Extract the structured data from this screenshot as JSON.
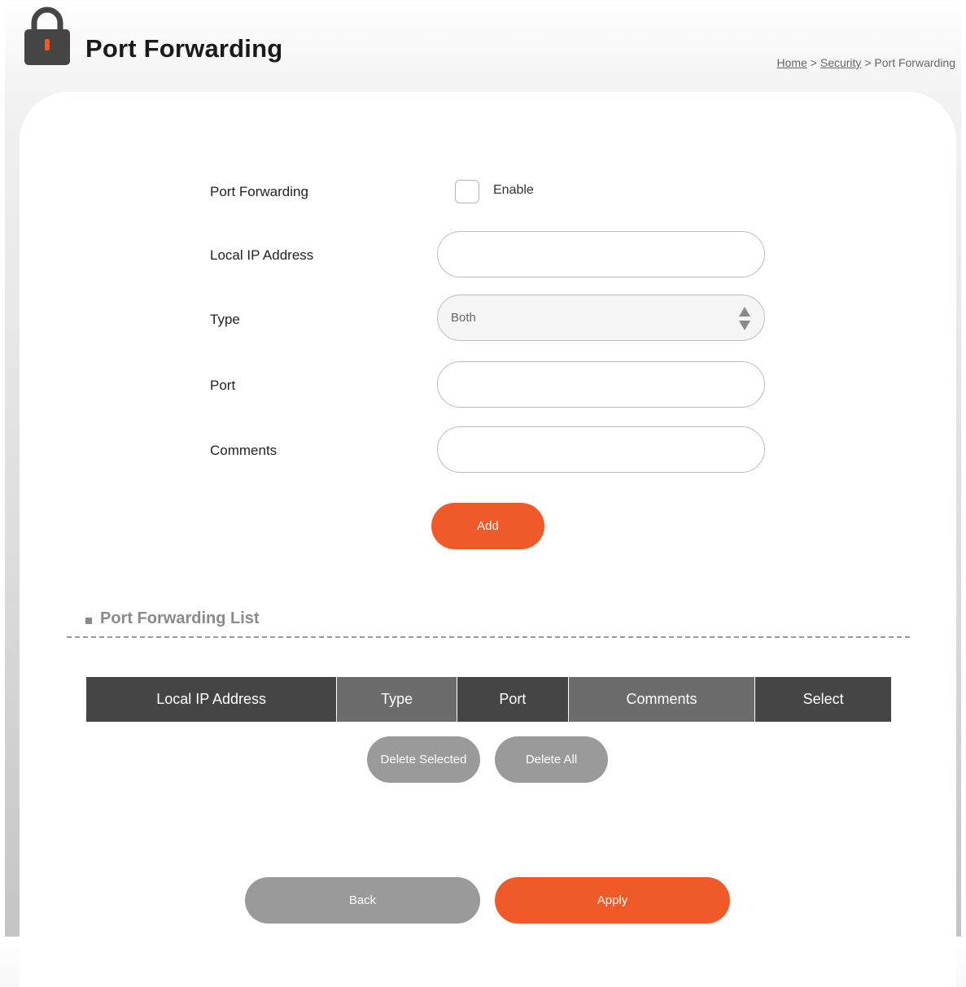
{
  "header": {
    "title": "Port Forwarding",
    "breadcrumb": {
      "home": "Home",
      "sep1": ">",
      "security": "Security",
      "sep2": ">",
      "current": "Port Forwarding"
    }
  },
  "form": {
    "port_forwarding_label": "Port Forwarding",
    "enable_label": "Enable",
    "enable_checked": false,
    "local_ip_label": "Local IP Address",
    "local_ip_value": "",
    "type_label": "Type",
    "type_value": "Both",
    "port_label": "Port",
    "port_value": "",
    "comments_label": "Comments",
    "comments_value": "",
    "add_button": "Add"
  },
  "list": {
    "title": "Port Forwarding List",
    "columns": [
      "Local IP Address",
      "Type",
      "Port",
      "Comments",
      "Select"
    ],
    "rows": [],
    "delete_selected_button": "Delete Selected",
    "delete_all_button": "Delete All"
  },
  "footer": {
    "back_button": "Back",
    "apply_button": "Apply"
  },
  "colors": {
    "accent": "#f05a28",
    "secondary_button": "#9a9a9a",
    "table_header_dark": "#454545",
    "table_header_mid": "#6c6c6c"
  },
  "icons": {
    "title_icon": "lock-icon",
    "type_select_icon": "sort-arrows-icon"
  }
}
